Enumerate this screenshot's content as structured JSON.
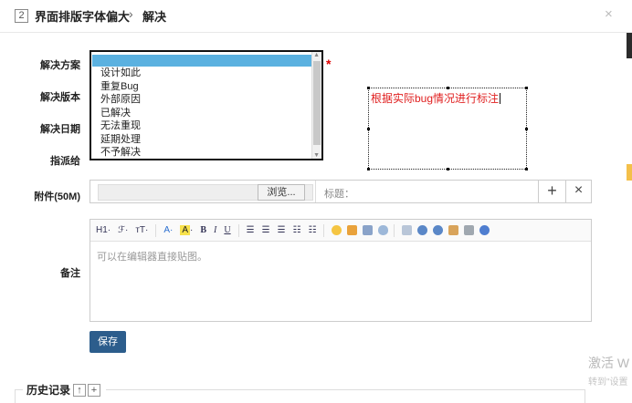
{
  "header": {
    "id": "2",
    "title": "界面排版字体偏大",
    "arrow": "›",
    "subtitle": "解决",
    "close": "×"
  },
  "form": {
    "labels": {
      "resolution": "解决方案",
      "version": "解决版本",
      "date": "解决日期",
      "assign": "指派给",
      "attachment": "附件(50M)",
      "notes": "备注"
    },
    "required_mark": "*",
    "resolution_options": [
      "",
      "设计如此",
      "重复Bug",
      "外部原因",
      "已解决",
      "无法重现",
      "延期处理",
      "不予解决"
    ],
    "selected_option": ""
  },
  "annotation": {
    "text": "根据实际bug情况进行标注"
  },
  "attachment": {
    "browse_label": "浏览...",
    "title_label": "标题：",
    "add_symbol": "+",
    "remove_symbol": "×"
  },
  "editor": {
    "toolbar": {
      "heading": "H1·",
      "font": "ℱ·",
      "size": "ᴛT·",
      "font_color": "A·",
      "highlight": "A",
      "highlight_suffix": "·",
      "bold": "B",
      "italic": "I",
      "underline": "U"
    },
    "placeholder": "可以在编辑器直接贴图。"
  },
  "save_label": "保存",
  "history": {
    "title": "历史记录",
    "up": "↑",
    "add": "+"
  },
  "watermark": {
    "line1": "激活 W",
    "line2": "转到\"设置"
  }
}
